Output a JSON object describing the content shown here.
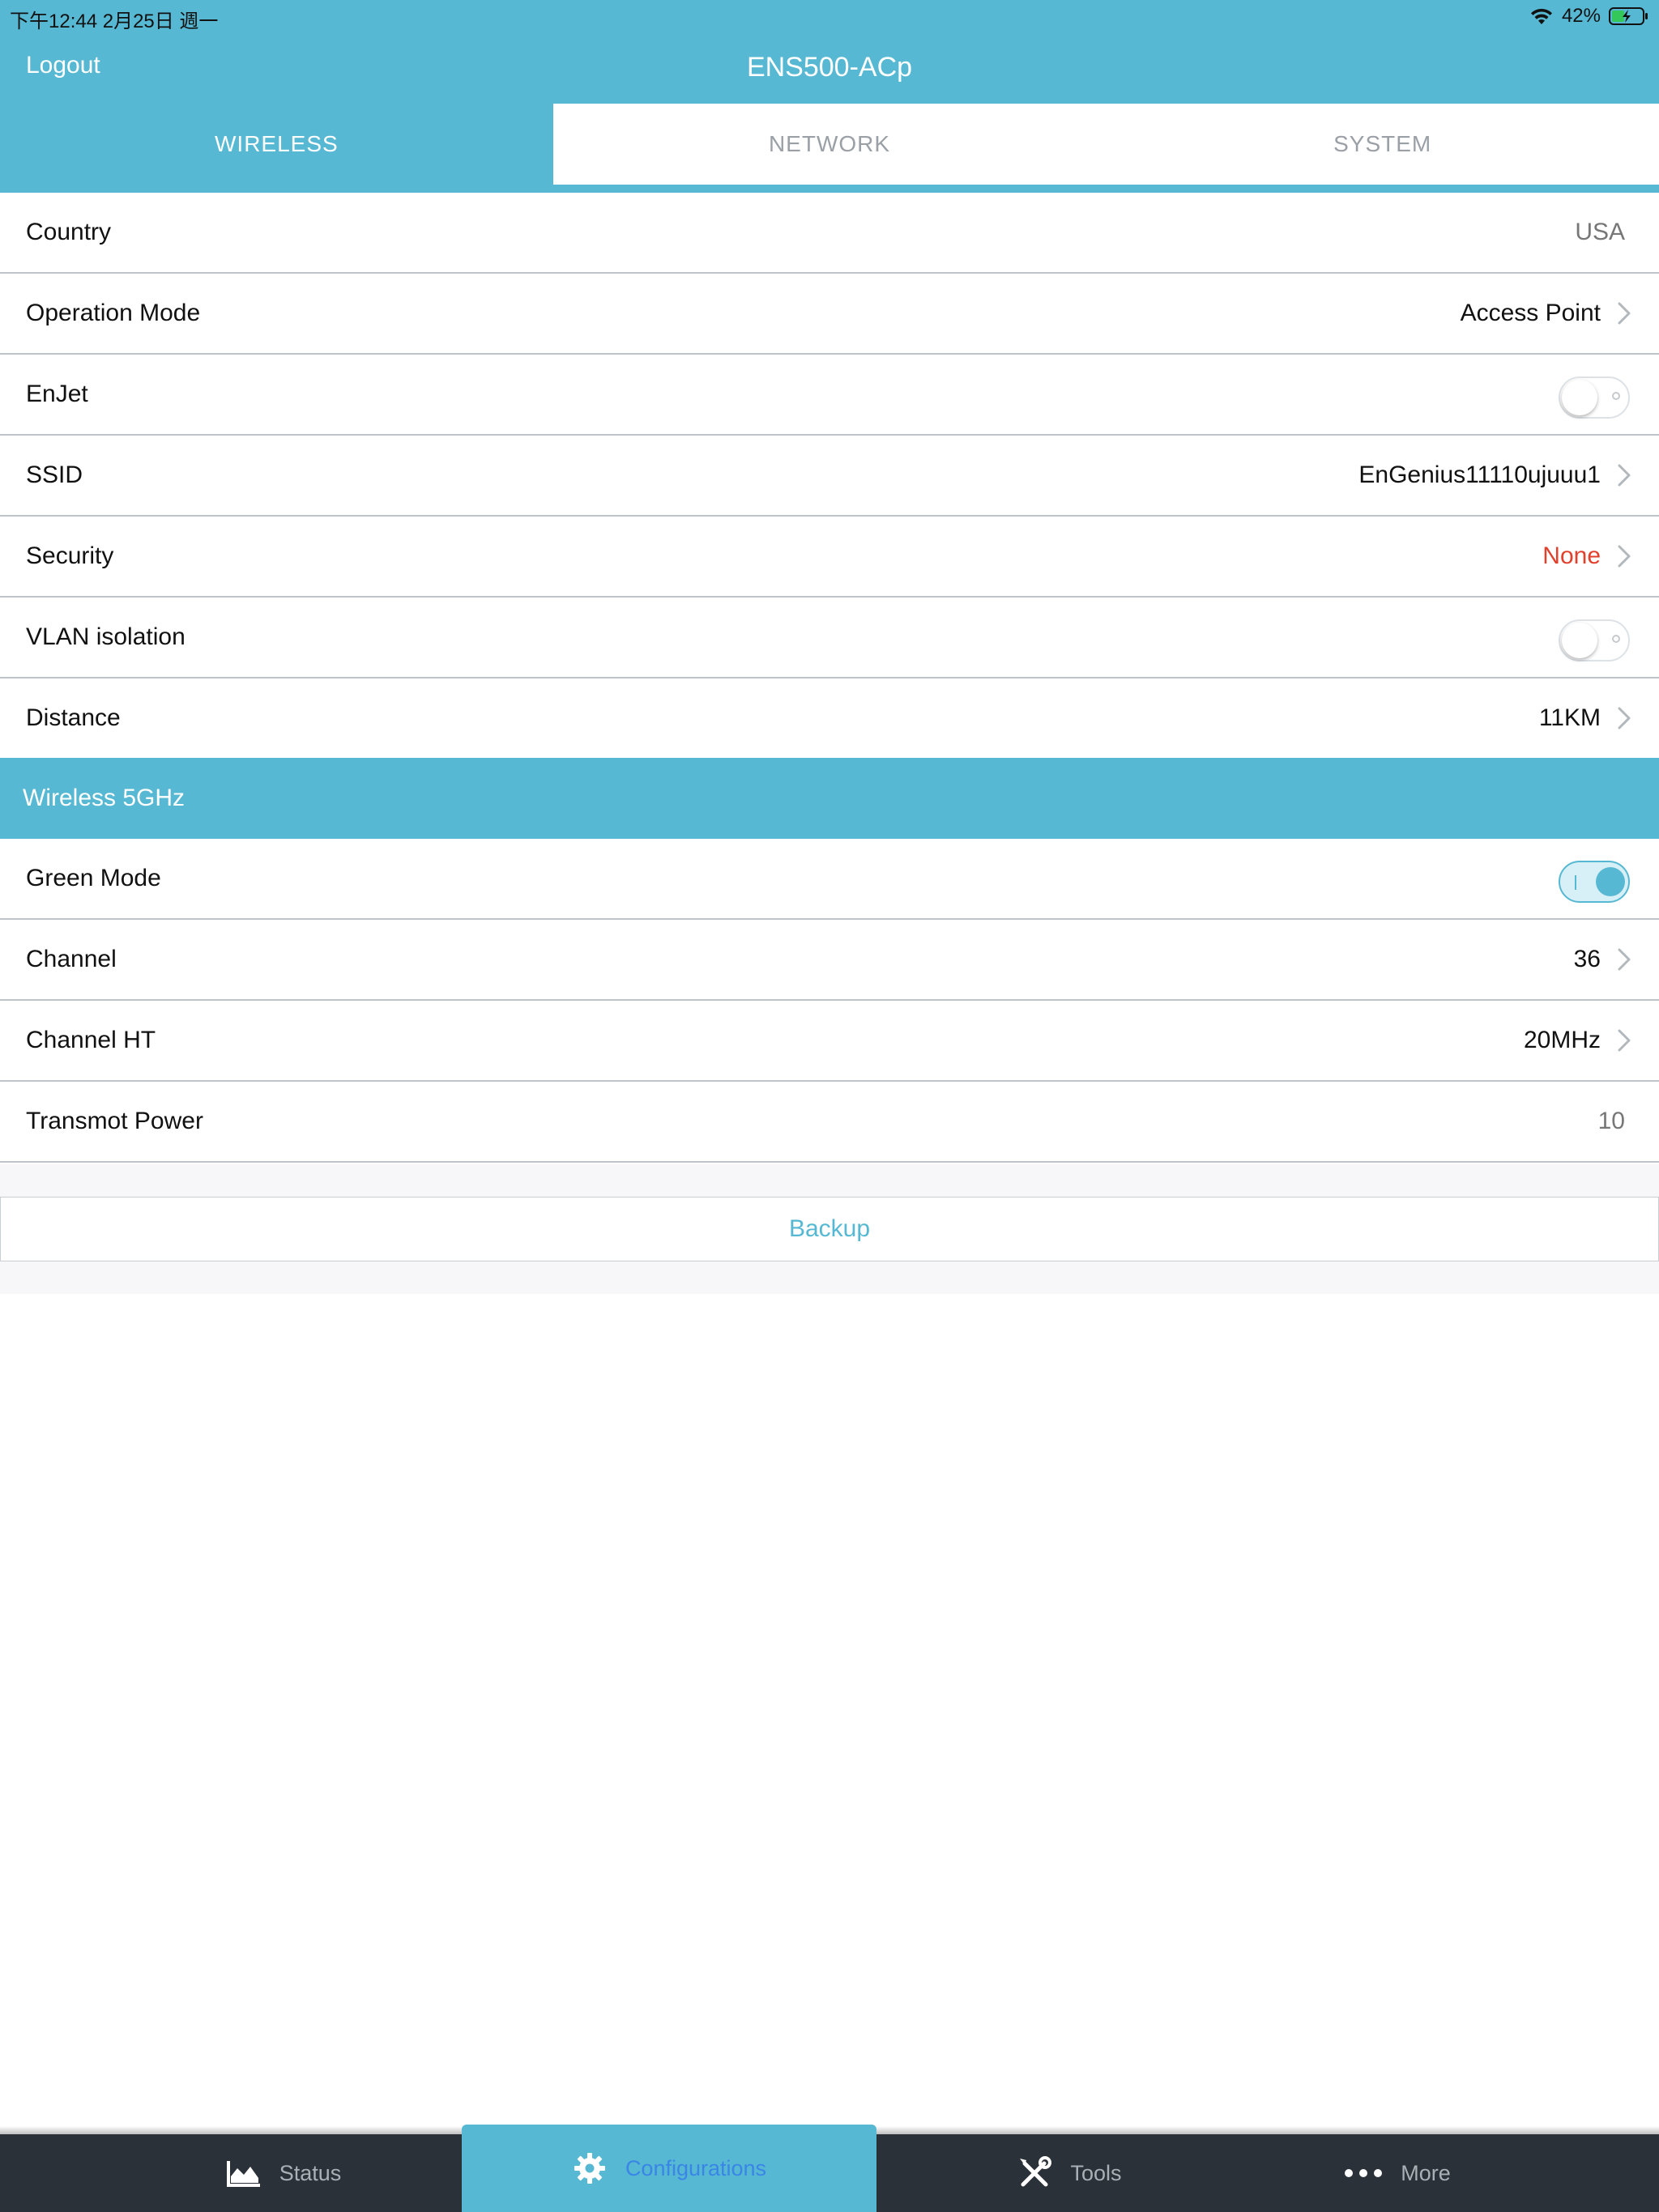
{
  "status_bar": {
    "time_date": "下午12:44   2月25日 週一",
    "battery_percent": "42%",
    "battery_level": 0.42
  },
  "header": {
    "logout_label": "Logout",
    "title": "ENS500-ACp"
  },
  "tabs": [
    {
      "label": "WIRELESS",
      "active": true
    },
    {
      "label": "NETWORK",
      "active": false
    },
    {
      "label": "SYSTEM",
      "active": false
    }
  ],
  "settings": {
    "country": {
      "label": "Country",
      "value": "USA"
    },
    "operation_mode": {
      "label": "Operation Mode",
      "value": "Access Point"
    },
    "enjet": {
      "label": "EnJet",
      "on": false
    },
    "ssid": {
      "label": "SSID",
      "value": "EnGenius11110ujuuu1"
    },
    "security": {
      "label": "Security",
      "value": "None"
    },
    "vlan_isolation": {
      "label": "VLAN isolation",
      "on": false
    },
    "distance": {
      "label": "Distance",
      "value": "11KM"
    }
  },
  "wireless_5ghz": {
    "section_title": "Wireless 5GHz",
    "green_mode": {
      "label": "Green Mode",
      "on": true
    },
    "channel": {
      "label": "Channel",
      "value": "36"
    },
    "channel_ht": {
      "label": "Channel HT",
      "value": "20MHz"
    },
    "transmit_power": {
      "label": "Transmot Power",
      "value": "10"
    }
  },
  "backup": {
    "label": "Backup"
  },
  "tab_bar": [
    {
      "label": "Status",
      "icon": "area-chart-icon",
      "active": false
    },
    {
      "label": "Configurations",
      "icon": "gear-icon",
      "active": true
    },
    {
      "label": "Tools",
      "icon": "tools-icon",
      "active": false
    },
    {
      "label": "More",
      "icon": "more-dots-icon",
      "active": false
    }
  ],
  "colors": {
    "accent": "#56b8d2",
    "danger": "#e1402c",
    "tab_bar_bg": "#2b3138",
    "active_tab_text": "#3a86e6"
  }
}
